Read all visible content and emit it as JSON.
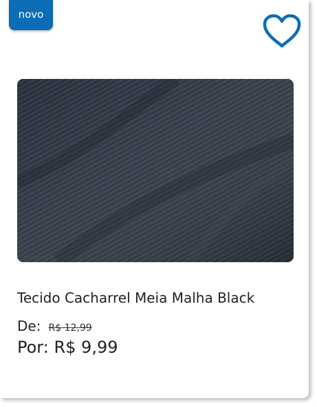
{
  "product": {
    "badge": "novo",
    "favorite_icon": "heart-outline-icon",
    "image_alt": "dark charcoal twill fabric",
    "title": "Tecido Cacharrel Meia Malha Black",
    "old_price_label": "De:",
    "old_price": "R$ 12,99",
    "new_price_label": "Por:",
    "new_price": "R$ 9,99"
  },
  "colors": {
    "accent": "#0b6db5",
    "fabric": "#2f3542"
  }
}
